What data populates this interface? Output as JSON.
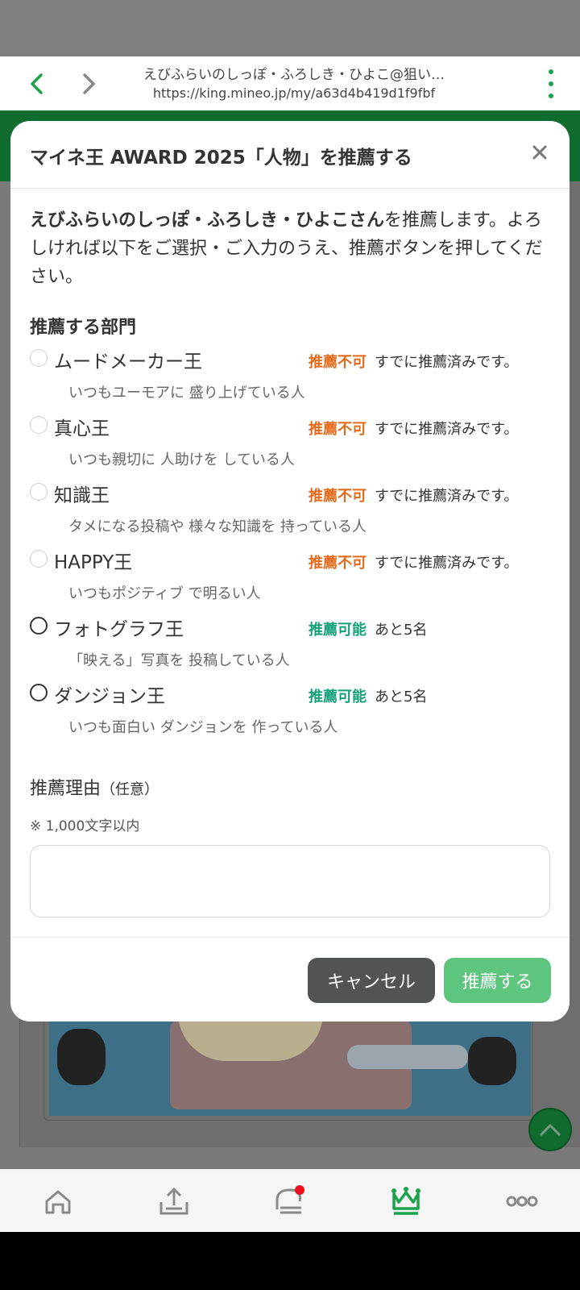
{
  "browser": {
    "page_title": "えびふらいのしっぽ・ふろしき・ひよこ@狙い…",
    "url": "https://king.mineo.jp/my/a63d4b419d1f9fbf"
  },
  "modal": {
    "title": "マイネ王 AWARD 2025「人物」を推薦する",
    "intro_name": "えびふらいのしっぽ・ふろしき・ひよこさん",
    "intro_rest": "を推薦します。よろしければ以下をご選択・ご入力のうえ、推薦ボタンを押してください。",
    "section_title": "推薦する部門",
    "options": [
      {
        "name": "ムードメーカー王",
        "desc": "いつもユーモアに 盛り上げている人",
        "status": "推薦不可",
        "note": "すでに推薦済みです。",
        "available": false
      },
      {
        "name": "真心王",
        "desc": "いつも親切に 人助けを している人",
        "status": "推薦不可",
        "note": "すでに推薦済みです。",
        "available": false
      },
      {
        "name": "知識王",
        "desc": "タメになる投稿や 様々な知識を 持っている人",
        "status": "推薦不可",
        "note": "すでに推薦済みです。",
        "available": false
      },
      {
        "name": "HAPPY王",
        "desc": "いつもポジティブ で明るい人",
        "status": "推薦不可",
        "note": "すでに推薦済みです。",
        "available": false
      },
      {
        "name": "フォトグラフ王",
        "desc": "「映える」写真を 投稿している人",
        "status": "推薦可能",
        "note": "あと5名",
        "available": true
      },
      {
        "name": "ダンジョン王",
        "desc": "いつも面白い ダンジョンを 作っている人",
        "status": "推薦可能",
        "note": "あと5名",
        "available": true
      }
    ],
    "reason_title": "推薦理由",
    "reason_optional": "（任意）",
    "reason_note": "※ 1,000文字以内",
    "reason_value": "",
    "cancel_label": "キャンセル",
    "submit_label": "推薦する"
  },
  "colors": {
    "brand_green": "#1aa34a",
    "unavailable": "#e46a1b",
    "available": "#15a07a",
    "submit_bg": "#5dc57e",
    "cancel_bg": "#505553",
    "notification_dot": "#e8101e"
  },
  "bottom_nav": {
    "items": [
      "home-icon",
      "upload-icon",
      "chat-icon",
      "crown-icon",
      "more-icon"
    ],
    "active": "crown-icon"
  }
}
